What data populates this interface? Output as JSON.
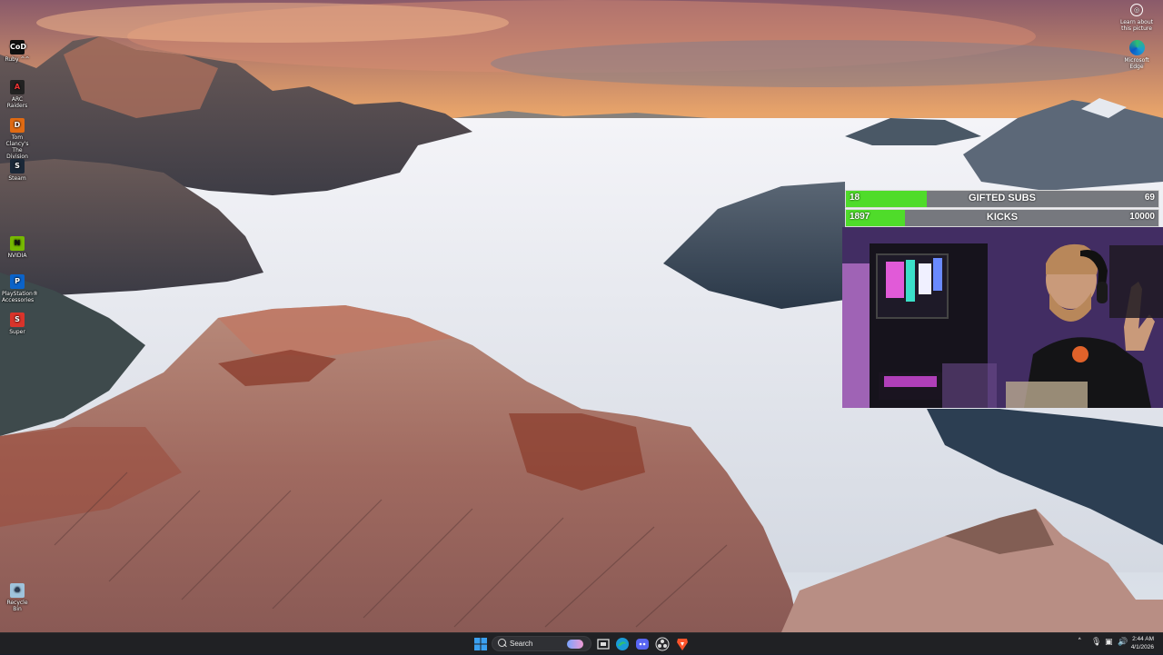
{
  "desktop": {
    "icons": [
      {
        "label": "Ruby ^^",
        "icon": "call-of-duty-icon",
        "color": "#111111"
      },
      {
        "label": "ARC Raiders",
        "icon": "arc-raiders-icon",
        "color": "#222222"
      },
      {
        "label": "Tom Clancy's The Division",
        "icon": "division-icon",
        "color": "#e06a12"
      },
      {
        "label": "Steam",
        "icon": "steam-icon",
        "color": "#1b2838"
      },
      {
        "label": "NVIDIA",
        "icon": "nvidia-icon",
        "color": "#76b900"
      },
      {
        "label": "PlayStation® Accessories",
        "icon": "playstation-icon",
        "color": "#0b63c9"
      },
      {
        "label": "Super",
        "icon": "super-icon",
        "color": "#d9342b"
      },
      {
        "label": "Recycle Bin",
        "icon": "recycle-bin-icon",
        "color": "#9fc3dc"
      }
    ],
    "learn_about_picture": "Learn about this picture",
    "edge_label": "Microsoft Edge"
  },
  "overlay": {
    "goals": [
      {
        "current": "18",
        "label": "GIFTED SUBS",
        "target": "69",
        "progress": 0.26
      },
      {
        "current": "1897",
        "label": "KICKS",
        "target": "10000",
        "progress": 0.19
      }
    ],
    "bar_color": "#4fdc2a"
  },
  "taskbar": {
    "search_placeholder": "Search",
    "apps": [
      {
        "name": "start-button",
        "icon": "windows-logo-icon"
      },
      {
        "name": "task-view",
        "icon": "task-view-icon"
      },
      {
        "name": "edge",
        "icon": "edge-icon"
      },
      {
        "name": "discord",
        "icon": "discord-icon"
      },
      {
        "name": "obs",
        "icon": "obs-icon"
      },
      {
        "name": "brave",
        "icon": "brave-icon"
      }
    ],
    "time": "2:44 AM",
    "date": "4/1/2026"
  }
}
